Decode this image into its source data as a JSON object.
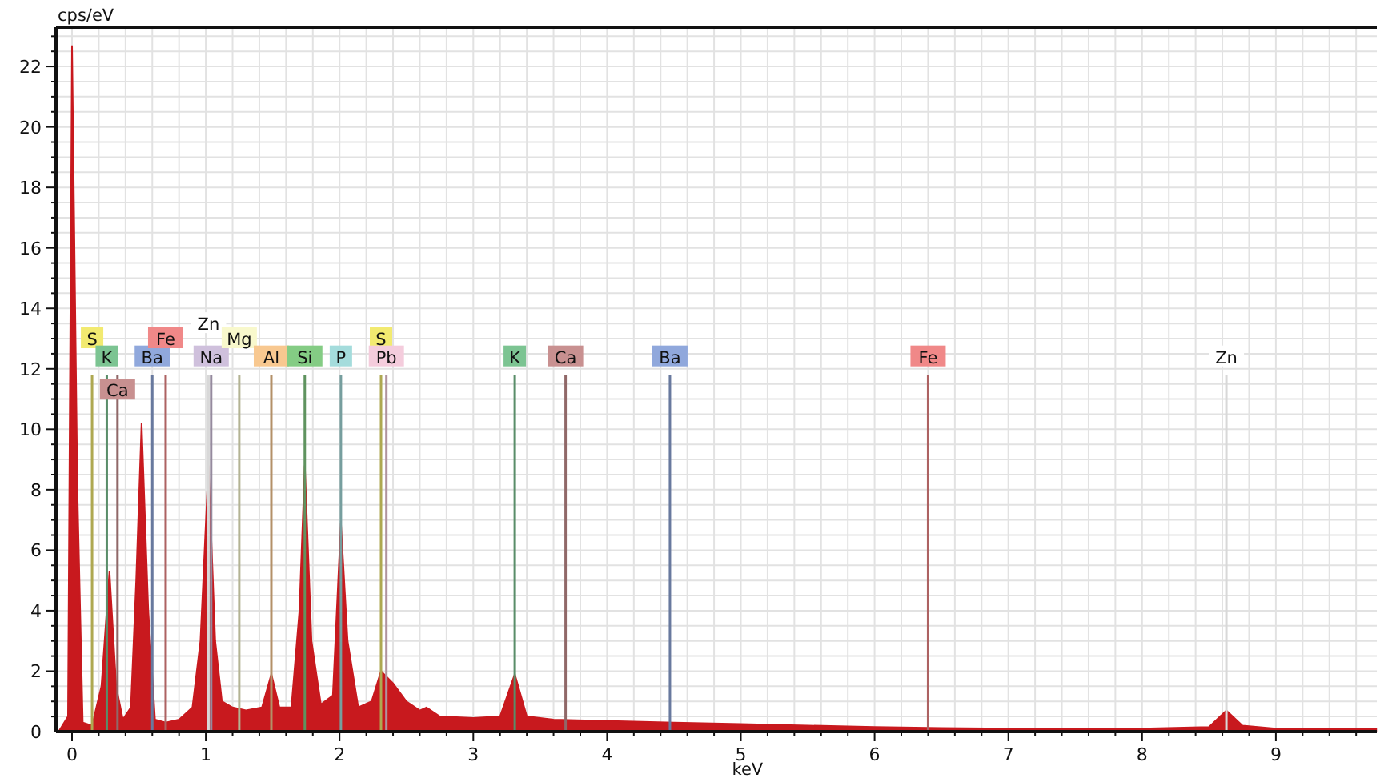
{
  "chart_data": {
    "type": "area",
    "ylabel": "cps/eV",
    "xlabel": "keV",
    "xlim": [
      -0.12,
      9.75
    ],
    "ylim": [
      0,
      23.3
    ],
    "grid": true,
    "xticks": [
      0,
      1,
      2,
      3,
      4,
      5,
      6,
      7,
      8,
      9
    ],
    "yticks": [
      0,
      2,
      4,
      6,
      8,
      10,
      12,
      14,
      16,
      18,
      20,
      22
    ],
    "x": [
      -0.1,
      -0.03,
      0,
      0.04,
      0.08,
      0.15,
      0.22,
      0.28,
      0.33,
      0.38,
      0.44,
      0.48,
      0.52,
      0.57,
      0.62,
      0.7,
      0.8,
      0.9,
      0.96,
      1.02,
      1.07,
      1.12,
      1.2,
      1.3,
      1.42,
      1.49,
      1.55,
      1.64,
      1.7,
      1.74,
      1.79,
      1.86,
      1.95,
      2.01,
      2.06,
      2.14,
      2.24,
      2.31,
      2.4,
      2.5,
      2.6,
      2.65,
      2.75,
      3.0,
      3.2,
      3.31,
      3.4,
      3.6,
      4.0,
      4.5,
      5.0,
      5.5,
      6.0,
      6.5,
      7.0,
      7.5,
      8.0,
      8.5,
      8.63,
      8.75,
      9.0,
      9.5,
      9.75
    ],
    "series": [
      {
        "color": "#c8191e",
        "values": [
          0,
          0.5,
          22.7,
          8,
          0.3,
          0.2,
          1.5,
          5.3,
          1.5,
          0.4,
          0.8,
          5,
          10.2,
          4,
          0.4,
          0.3,
          0.4,
          0.8,
          3,
          8.8,
          3,
          1,
          0.8,
          0.7,
          0.8,
          1.9,
          0.8,
          0.8,
          4,
          8.8,
          3,
          0.9,
          1.2,
          6.9,
          3,
          0.8,
          1,
          2.0,
          1.6,
          1,
          0.7,
          0.8,
          0.5,
          0.45,
          0.5,
          1.9,
          0.5,
          0.4,
          0.35,
          0.3,
          0.25,
          0.2,
          0.15,
          0.12,
          0.1,
          0.1,
          0.1,
          0.15,
          0.7,
          0.2,
          0.1,
          0.1,
          0.1
        ]
      }
    ],
    "annotations": [
      {
        "text": "S",
        "x": 0.15,
        "y": 13.0
      },
      {
        "text": "K",
        "x": 0.26,
        "y": 12.4
      },
      {
        "text": "Ca",
        "x": 0.34,
        "y": 11.3
      },
      {
        "text": "Ba",
        "x": 0.6,
        "y": 12.4
      },
      {
        "text": "Fe",
        "x": 0.7,
        "y": 13.0
      },
      {
        "text": "Zn",
        "x": 1.02,
        "y": 13.5
      },
      {
        "text": "Na",
        "x": 1.04,
        "y": 12.4
      },
      {
        "text": "Mg",
        "x": 1.25,
        "y": 13.0
      },
      {
        "text": "Al",
        "x": 1.49,
        "y": 12.4
      },
      {
        "text": "Si",
        "x": 1.74,
        "y": 12.4
      },
      {
        "text": "P",
        "x": 2.01,
        "y": 12.4
      },
      {
        "text": "S",
        "x": 2.31,
        "y": 13.0
      },
      {
        "text": "Pb",
        "x": 2.35,
        "y": 12.4
      },
      {
        "text": "K",
        "x": 3.31,
        "y": 12.4
      },
      {
        "text": "Ca",
        "x": 3.69,
        "y": 12.4
      },
      {
        "text": "Ba",
        "x": 4.47,
        "y": 12.4
      },
      {
        "text": "Fe",
        "x": 6.4,
        "y": 12.4
      },
      {
        "text": "Zn",
        "x": 8.63,
        "y": 12.4
      }
    ]
  },
  "element_labels": [
    {
      "color": "#f2ea70"
    },
    {
      "color": "#7cc492"
    },
    {
      "color": "#c89090"
    },
    {
      "color": "#90a8dc"
    },
    {
      "color": "#f08888"
    },
    {
      "color": "#ffffff"
    },
    {
      "color": "#cfc0dc"
    },
    {
      "color": "#f8f8cc"
    },
    {
      "color": "#f8c890"
    },
    {
      "color": "#84cc84"
    },
    {
      "color": "#a4dcdc"
    },
    {
      "color": "#f2ea70"
    },
    {
      "color": "#f4ccdc"
    },
    {
      "color": "#7cc492"
    },
    {
      "color": "#c89090"
    },
    {
      "color": "#90a8dc"
    },
    {
      "color": "#f08888"
    },
    {
      "color": "#ffffff"
    }
  ]
}
